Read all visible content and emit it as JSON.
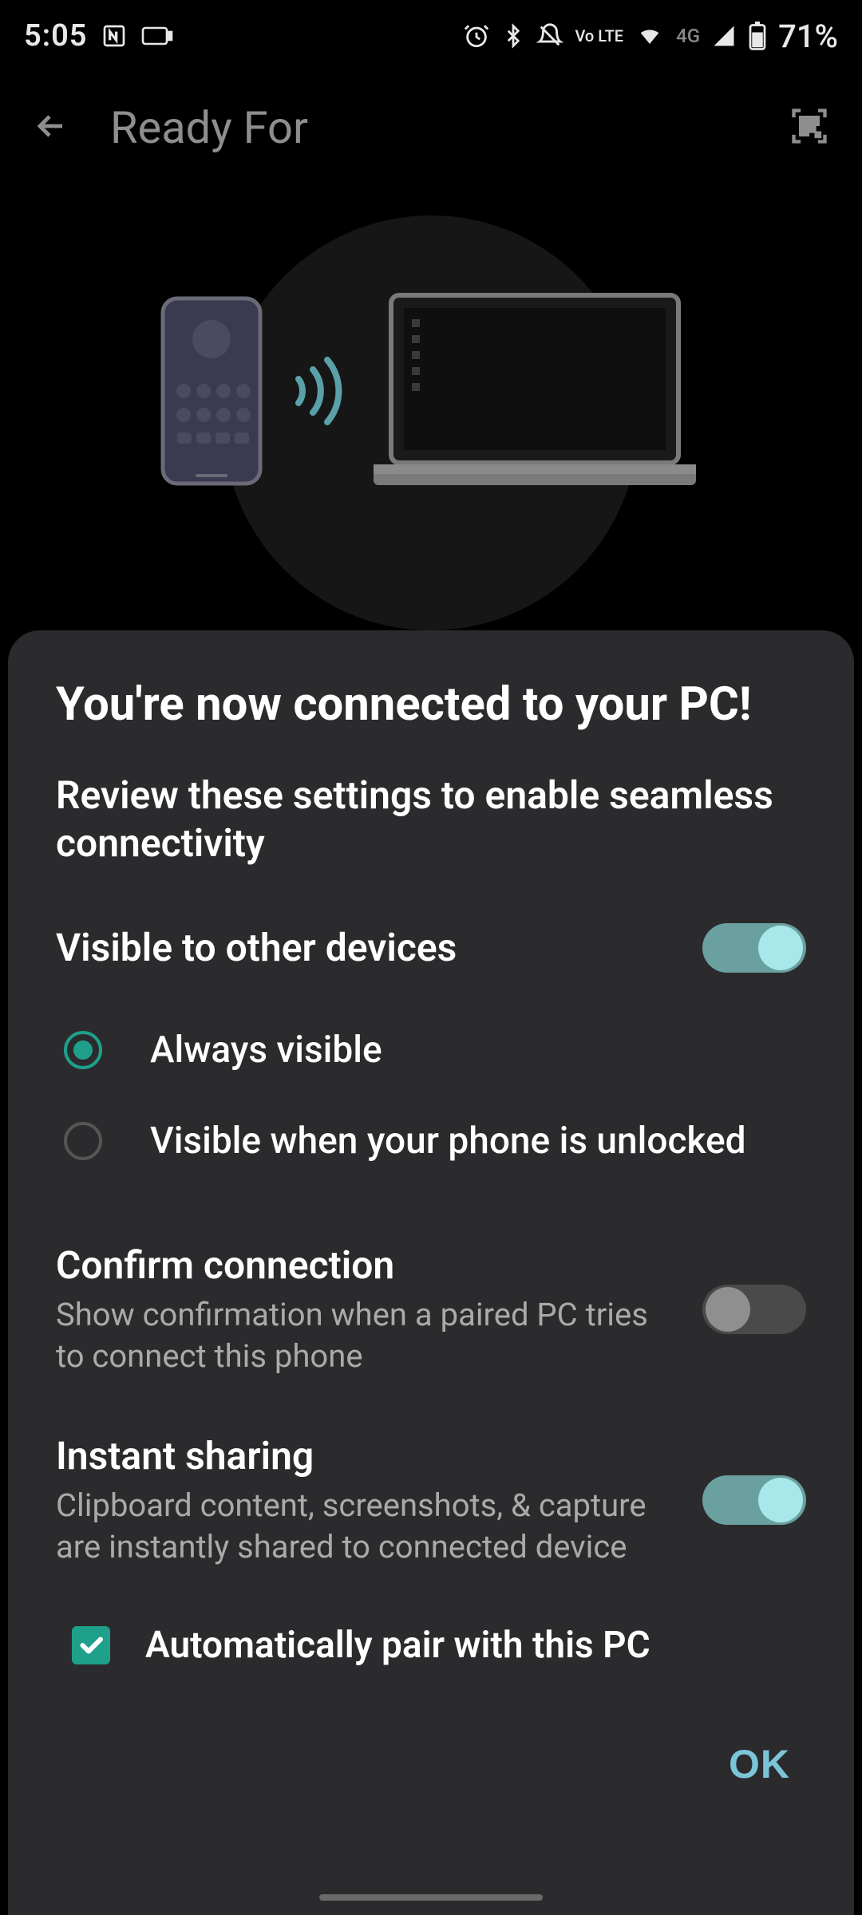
{
  "status": {
    "time": "5:05",
    "battery_pct": "71%",
    "network_label": "4G",
    "volte_label": "Vo LTE"
  },
  "appbar": {
    "title": "Ready For"
  },
  "sheet": {
    "title": "You're now connected to your PC!",
    "subtitle": "Review these settings to enable seamless connectivity",
    "visible": {
      "label": "Visible to other devices",
      "enabled": true,
      "options": [
        {
          "label": "Always visible",
          "selected": true
        },
        {
          "label": "Visible when your phone is unlocked",
          "selected": false
        }
      ]
    },
    "confirm": {
      "label": "Confirm connection",
      "desc": "Show confirmation when a paired PC tries to connect this phone",
      "enabled": false
    },
    "instant": {
      "label": "Instant sharing",
      "desc": "Clipboard content, screenshots, & capture are instantly shared to connected device",
      "enabled": true
    },
    "autopair": {
      "label": "Automatically pair with this PC",
      "checked": true
    },
    "ok_label": "OK"
  }
}
